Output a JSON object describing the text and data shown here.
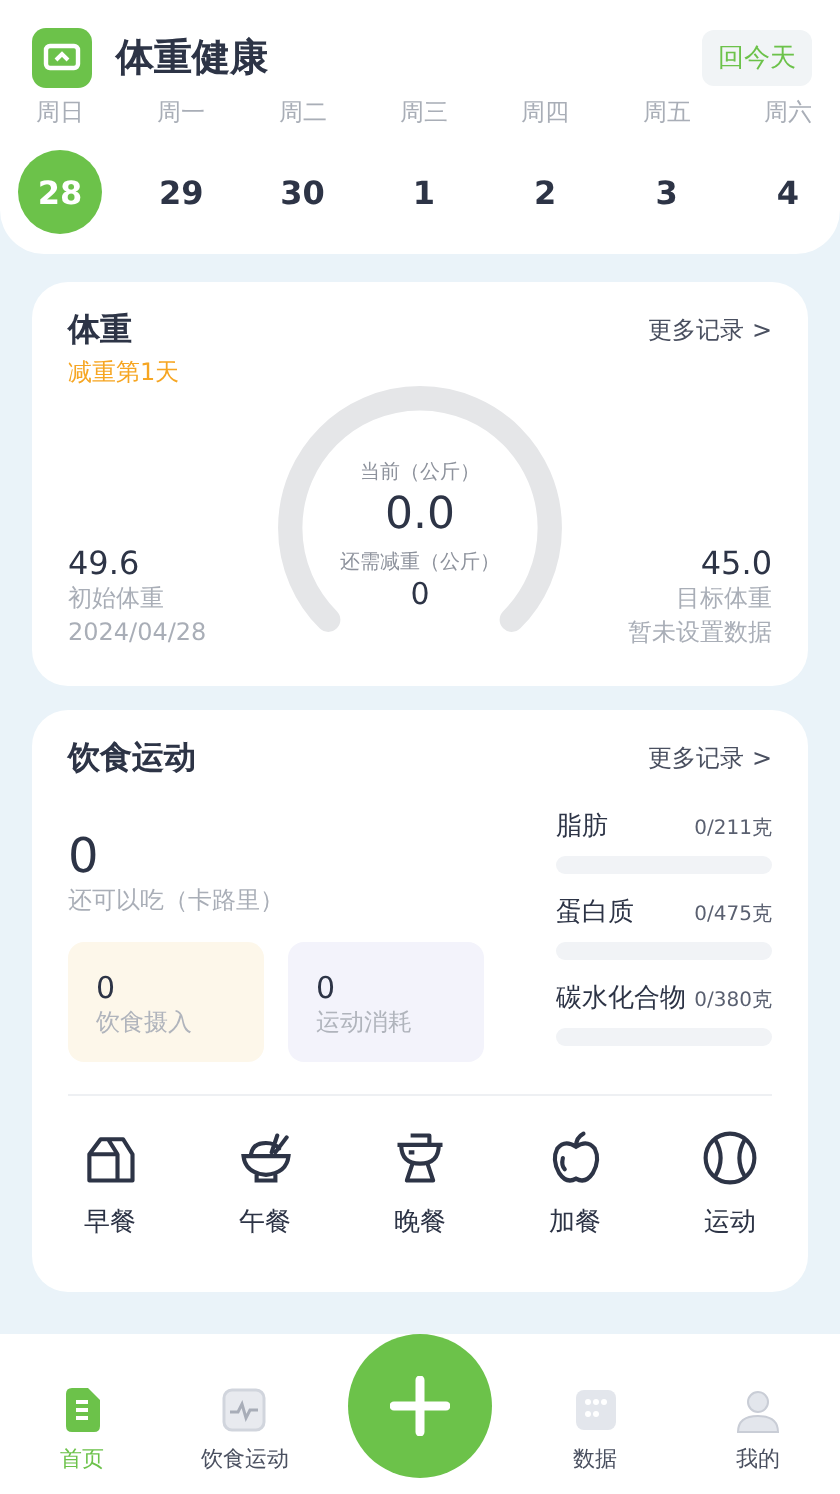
{
  "header": {
    "title": "体重健康",
    "today_button": "回今天"
  },
  "week": [
    {
      "weekday": "周日",
      "day": "28",
      "selected": true
    },
    {
      "weekday": "周一",
      "day": "29",
      "selected": false
    },
    {
      "weekday": "周二",
      "day": "30",
      "selected": false
    },
    {
      "weekday": "周三",
      "day": "1",
      "selected": false
    },
    {
      "weekday": "周四",
      "day": "2",
      "selected": false
    },
    {
      "weekday": "周五",
      "day": "3",
      "selected": false
    },
    {
      "weekday": "周六",
      "day": "4",
      "selected": false
    }
  ],
  "weight_card": {
    "title": "体重",
    "more": "更多记录 >",
    "streak": "减重第1天",
    "gauge": {
      "current_label": "当前（公斤）",
      "current": "0.0",
      "remaining_label": "还需减重（公斤）",
      "remaining": "0"
    },
    "start": {
      "value": "49.6",
      "label": "初始体重",
      "date": "2024/04/28"
    },
    "target": {
      "value": "45.0",
      "label": "目标体重",
      "note": "暂未设置数据"
    }
  },
  "diet_card": {
    "title": "饮食运动",
    "more": "更多记录 >",
    "calories": "0",
    "calories_label": "还可以吃（卡路里）",
    "intake": {
      "value": "0",
      "label": "饮食摄入"
    },
    "burn": {
      "value": "0",
      "label": "运动消耗"
    },
    "macros": [
      {
        "name": "脂肪",
        "amount": "0/211克"
      },
      {
        "name": "蛋白质",
        "amount": "0/475克"
      },
      {
        "name": "碳水化合物",
        "amount": "0/380克"
      }
    ],
    "meals": [
      {
        "kind": "breakfast",
        "label": "早餐"
      },
      {
        "kind": "lunch",
        "label": "午餐"
      },
      {
        "kind": "dinner",
        "label": "晚餐"
      },
      {
        "kind": "snack",
        "label": "加餐"
      },
      {
        "kind": "sport",
        "label": "运动"
      }
    ]
  },
  "tabbar": [
    {
      "kind": "home",
      "label": "首页",
      "selected": true
    },
    {
      "kind": "activity",
      "label": "饮食运动",
      "selected": false
    },
    {
      "kind": "add"
    },
    {
      "kind": "data",
      "label": "数据",
      "selected": false
    },
    {
      "kind": "me",
      "label": "我的",
      "selected": false
    }
  ]
}
